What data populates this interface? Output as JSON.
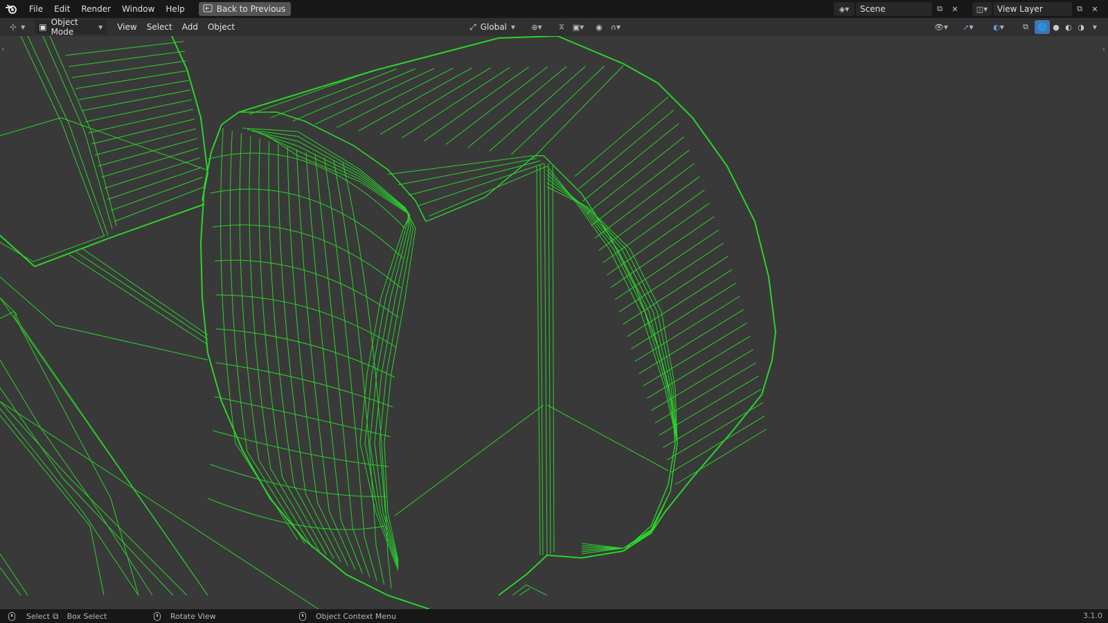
{
  "menubar": {
    "items": [
      "File",
      "Edit",
      "Render",
      "Window",
      "Help"
    ],
    "back_button": "Back to Previous",
    "scene": "Scene",
    "view_layer": "View Layer"
  },
  "header": {
    "mode": "Object Mode",
    "menus": [
      "View",
      "Select",
      "Add",
      "Object"
    ],
    "transform_orientation": "Global"
  },
  "statusbar": {
    "select": "Select",
    "box_select": "Box Select",
    "rotate_view": "Rotate View",
    "context_menu": "Object Context Menu",
    "version": "3.1.0"
  },
  "colors": {
    "wire": "#2ad42a",
    "viewport_bg": "#393939",
    "topbar_bg": "#181818",
    "header_bg": "#303030"
  }
}
